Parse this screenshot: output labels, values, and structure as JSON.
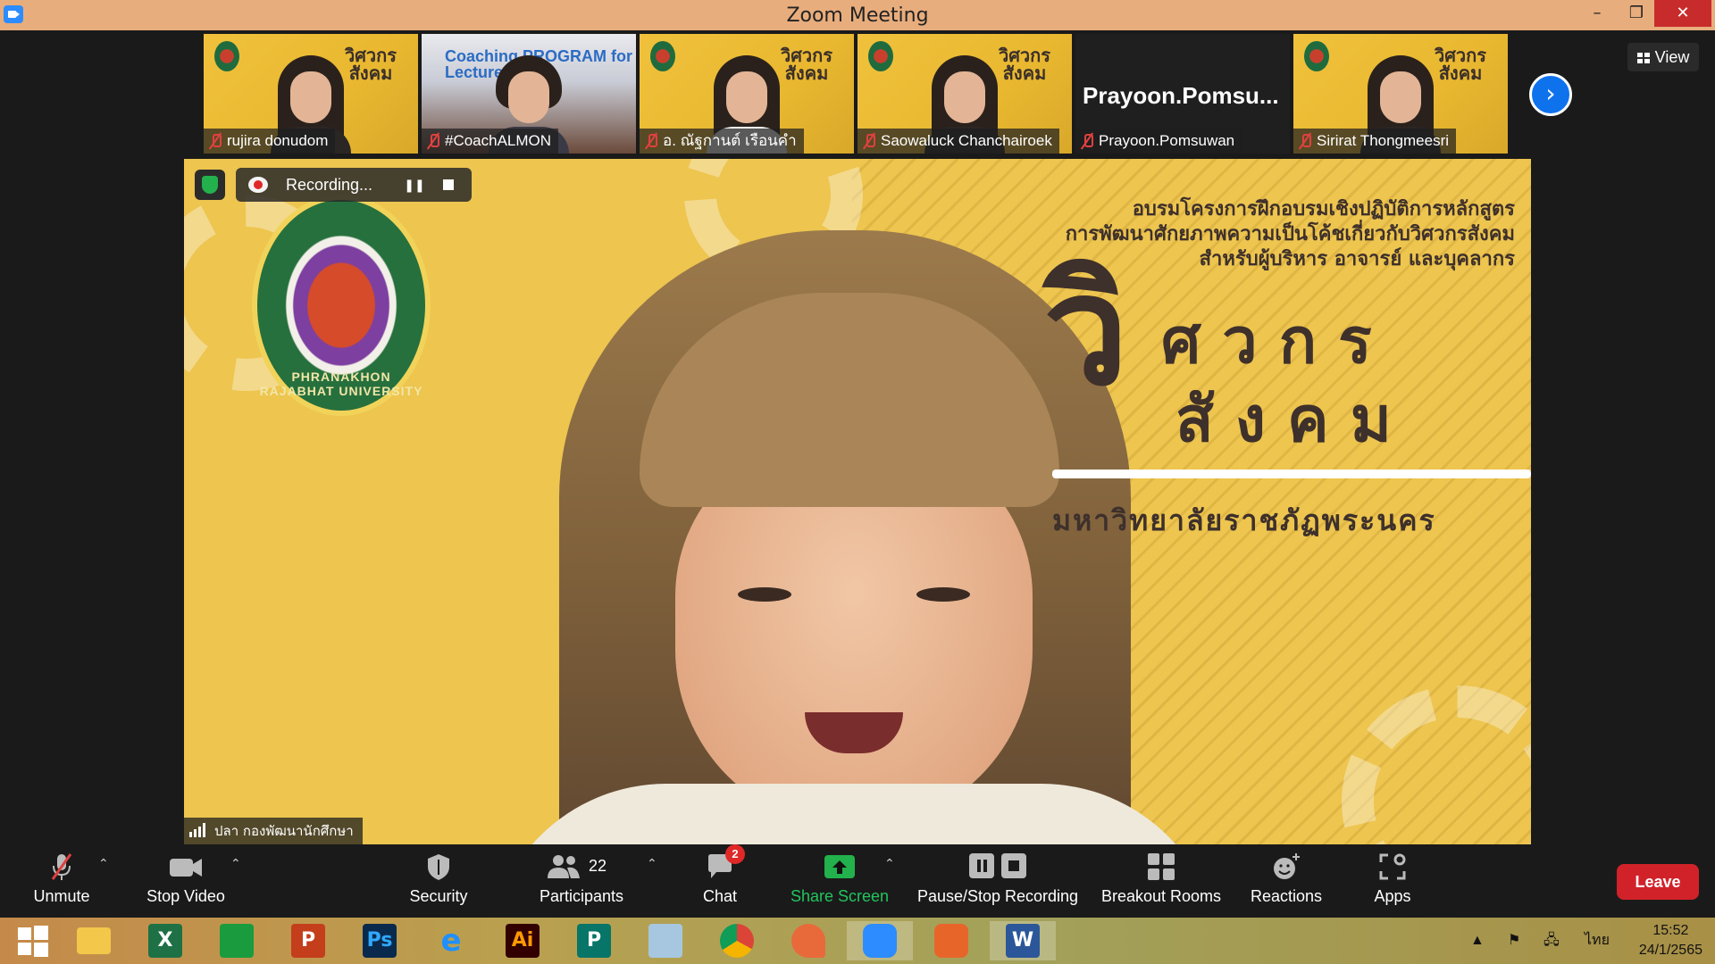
{
  "window": {
    "title": "Zoom Meeting",
    "minimize": "–",
    "restore": "❐",
    "close": "✕"
  },
  "thumbnails": [
    {
      "name": "rujira donudom",
      "muted": true
    },
    {
      "name": "#CoachALMON",
      "muted": true,
      "overlay_text": "Coaching PROGRAM for Lecturer"
    },
    {
      "name": "อ. ณัฐกานต์  เรือนคำ",
      "muted": true
    },
    {
      "name": "Saowaluck Chanchairoek",
      "muted": true
    },
    {
      "name": "Prayoon.Pomsuwan",
      "muted": true,
      "display_text": "Prayoon.Pomsu..."
    },
    {
      "name": "Sirirat Thongmeesri",
      "muted": true
    }
  ],
  "thumb_slide_text": "วิศวกร สังคม",
  "view_button": "View",
  "next_page_icon": "chevron-right-icon",
  "recording": {
    "label": "Recording...",
    "pause_icon": "pause-icon",
    "stop_icon": "stop-icon"
  },
  "main_slide": {
    "line1": "อบรมโครงการฝึกอบรมเชิงปฏิบัติการหลักสูตร",
    "line2": "การพัฒนาศักยภาพความเป็นโค้ชเกี่ยวกับวิศวกรสังคม",
    "line3": "สำหรับผู้บริหาร อาจารย์ และบุคลากร",
    "big_vi": "วิ",
    "big_rest1": "ศวกร",
    "big_rest2": "สังคม",
    "university": "มหาวิทยาลัยราชภัฏพระนคร",
    "seal_text": "PHRANAKHON RAJABHAT UNIVERSITY"
  },
  "active_speaker": "ปลา กองพัฒนานักศึกษา",
  "toolbar": {
    "unmute": "Unmute",
    "stop_video": "Stop Video",
    "security": "Security",
    "participants": "Participants",
    "participants_count": "22",
    "chat": "Chat",
    "chat_badge": "2",
    "share_screen": "Share Screen",
    "pause_stop_recording": "Pause/Stop Recording",
    "breakout_rooms": "Breakout Rooms",
    "reactions": "Reactions",
    "apps": "Apps",
    "leave": "Leave"
  },
  "colors": {
    "titlebar": "#e8ad7d",
    "accent_blue": "#0e72ed",
    "share_green": "#22b14c",
    "leave_red": "#d1222a",
    "slide_yellow": "#edc54f"
  },
  "taskbar": {
    "apps": [
      {
        "icon": "windows-start-icon",
        "text": ""
      },
      {
        "icon": "file-explorer-icon",
        "text": ""
      },
      {
        "icon": "excel-icon",
        "text": "X"
      },
      {
        "icon": "store-icon",
        "text": ""
      },
      {
        "icon": "powerpoint-icon",
        "text": "P"
      },
      {
        "icon": "photoshop-icon",
        "text": "Ps"
      },
      {
        "icon": "internet-explorer-icon",
        "text": "e"
      },
      {
        "icon": "illustrator-icon",
        "text": "Ai"
      },
      {
        "icon": "publisher-icon",
        "text": "P"
      },
      {
        "icon": "generic-app-icon",
        "text": ""
      },
      {
        "icon": "chrome-icon",
        "text": ""
      },
      {
        "icon": "paint-icon",
        "text": ""
      },
      {
        "icon": "zoom-icon",
        "text": ""
      },
      {
        "icon": "office-icon",
        "text": ""
      },
      {
        "icon": "word-icon",
        "text": "W"
      }
    ],
    "language": "ไทย",
    "time": "15:52",
    "date": "24/1/2565"
  }
}
